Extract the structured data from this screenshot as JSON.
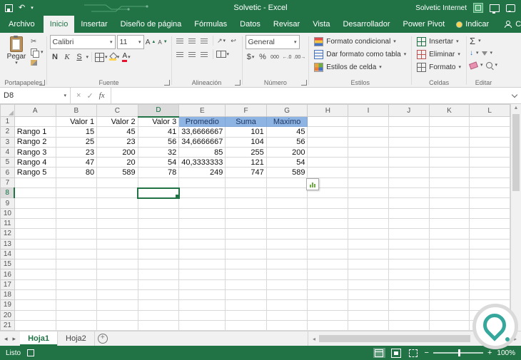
{
  "title_bar": {
    "title": "Solvetic  -  Excel",
    "network_label": "Solvetic Internet"
  },
  "ribbon_tabs": {
    "file": "Archivo",
    "tabs": [
      "Inicio",
      "Insertar",
      "Diseño de página",
      "Fórmulas",
      "Datos",
      "Revisar",
      "Vista",
      "Desarrollador",
      "Power Pivot"
    ],
    "active": "Inicio",
    "tell_me": "Indicar",
    "share": "Compartir"
  },
  "ribbon": {
    "clipboard": {
      "label": "Portapapeles",
      "paste": "Pegar"
    },
    "font": {
      "label": "Fuente",
      "family": "Calibri",
      "size": "11",
      "bold": "N",
      "italic": "K",
      "underline": "S"
    },
    "alignment": {
      "label": "Alineación"
    },
    "number": {
      "label": "Número",
      "format": "General",
      "zeros": "000",
      "currency": "$",
      "percent": "%"
    },
    "styles": {
      "label": "Estilos",
      "conditional": "Formato condicional",
      "format_table": "Dar formato como tabla",
      "cell_styles": "Estilos de celda"
    },
    "cells": {
      "label": "Celdas",
      "insert": "Insertar",
      "delete": "Eliminar",
      "format": "Formato"
    },
    "editing": {
      "label": "Editar"
    }
  },
  "formula_bar": {
    "name_box": "D8",
    "fx_label": "fx",
    "value": ""
  },
  "grid": {
    "col_headers": [
      "A",
      "B",
      "C",
      "D",
      "E",
      "F",
      "G",
      "H",
      "I",
      "J",
      "K",
      "L"
    ],
    "row_count": 21,
    "selected_cell": "D8",
    "selected_col": "D",
    "selected_row": 8,
    "blue_header_cols": [
      "E",
      "F",
      "G"
    ],
    "rows": [
      {
        "n": 1,
        "cells": {
          "B": "Valor 1",
          "C": "Valor 2",
          "D": "Valor 3",
          "E": "Promedio",
          "F": "Suma",
          "G": "Maximo"
        }
      },
      {
        "n": 2,
        "cells": {
          "A": "Rango 1",
          "B": "15",
          "C": "45",
          "D": "41",
          "E": "33,6666667",
          "F": "101",
          "G": "45"
        }
      },
      {
        "n": 3,
        "cells": {
          "A": "Rango 2",
          "B": "25",
          "C": "23",
          "D": "56",
          "E": "34,6666667",
          "F": "104",
          "G": "56"
        }
      },
      {
        "n": 4,
        "cells": {
          "A": "Rango 3",
          "B": "23",
          "C": "200",
          "D": "32",
          "E": "85",
          "F": "255",
          "G": "200"
        }
      },
      {
        "n": 5,
        "cells": {
          "A": "Rango 4",
          "B": "47",
          "C": "20",
          "D": "54",
          "E": "40,3333333",
          "F": "121",
          "G": "54"
        }
      },
      {
        "n": 6,
        "cells": {
          "A": "Rango 5",
          "B": "80",
          "C": "589",
          "D": "78",
          "E": "249",
          "F": "747",
          "G": "589"
        }
      }
    ]
  },
  "sheet_tabs": {
    "tabs": [
      "Hoja1",
      "Hoja2"
    ],
    "active": "Hoja1"
  },
  "status_bar": {
    "mode": "Listo",
    "zoom": "100%"
  },
  "colors": {
    "accent": "#217346",
    "blue_fill": "#8EB4E3"
  }
}
